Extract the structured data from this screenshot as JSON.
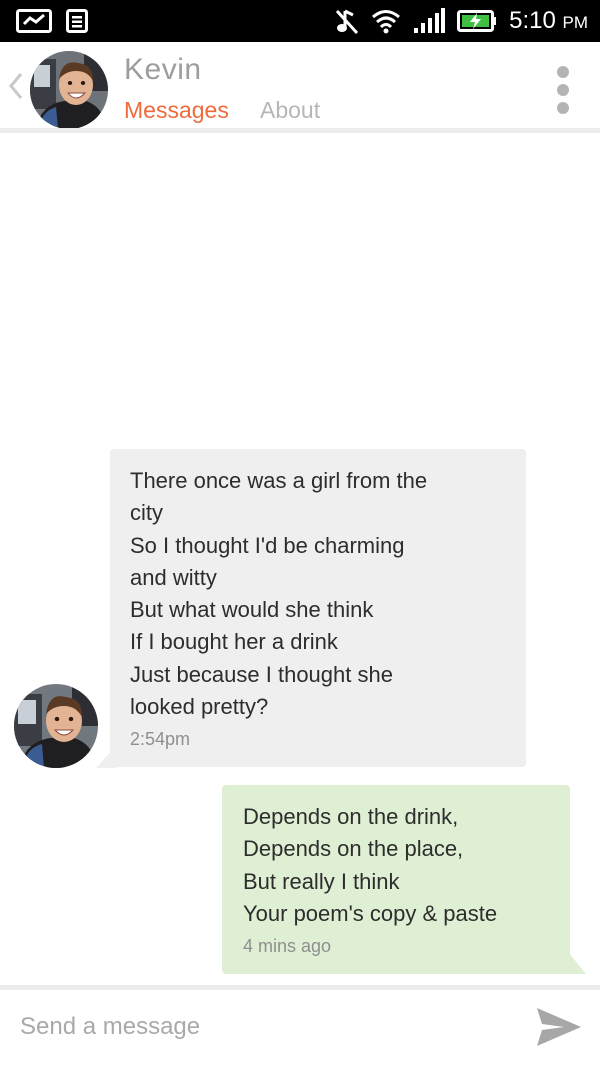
{
  "status_bar": {
    "time": "5:10",
    "ampm": "PM",
    "icons": [
      "voicemail-icon",
      "notes-icon",
      "mute-icon",
      "wifi-icon",
      "signal-icon",
      "battery-charging-icon"
    ]
  },
  "header": {
    "contact_name": "Kevin",
    "tabs": [
      {
        "label": "Messages",
        "active": true
      },
      {
        "label": "About",
        "active": false
      }
    ],
    "icons": [
      "back-chevron-icon",
      "more-vert-icon"
    ]
  },
  "messages": [
    {
      "direction": "incoming",
      "lines": [
        "There once was a girl from the",
        "city",
        "So I thought I'd be charming",
        "and witty",
        "But what would she think",
        "If I bought her a drink",
        "Just because I thought she",
        "looked pretty?"
      ],
      "time": "2:54pm"
    },
    {
      "direction": "outgoing",
      "lines": [
        "Depends on the drink,",
        "Depends on the place,",
        "But really I think",
        "Your poem's copy & paste"
      ],
      "time": "4 mins ago"
    }
  ],
  "composer": {
    "placeholder": "Send a message",
    "icon": "send-icon"
  },
  "colors": {
    "accent": "#ef6a3c",
    "incoming_bubble": "#efefef",
    "outgoing_bubble": "#dfefd3"
  }
}
